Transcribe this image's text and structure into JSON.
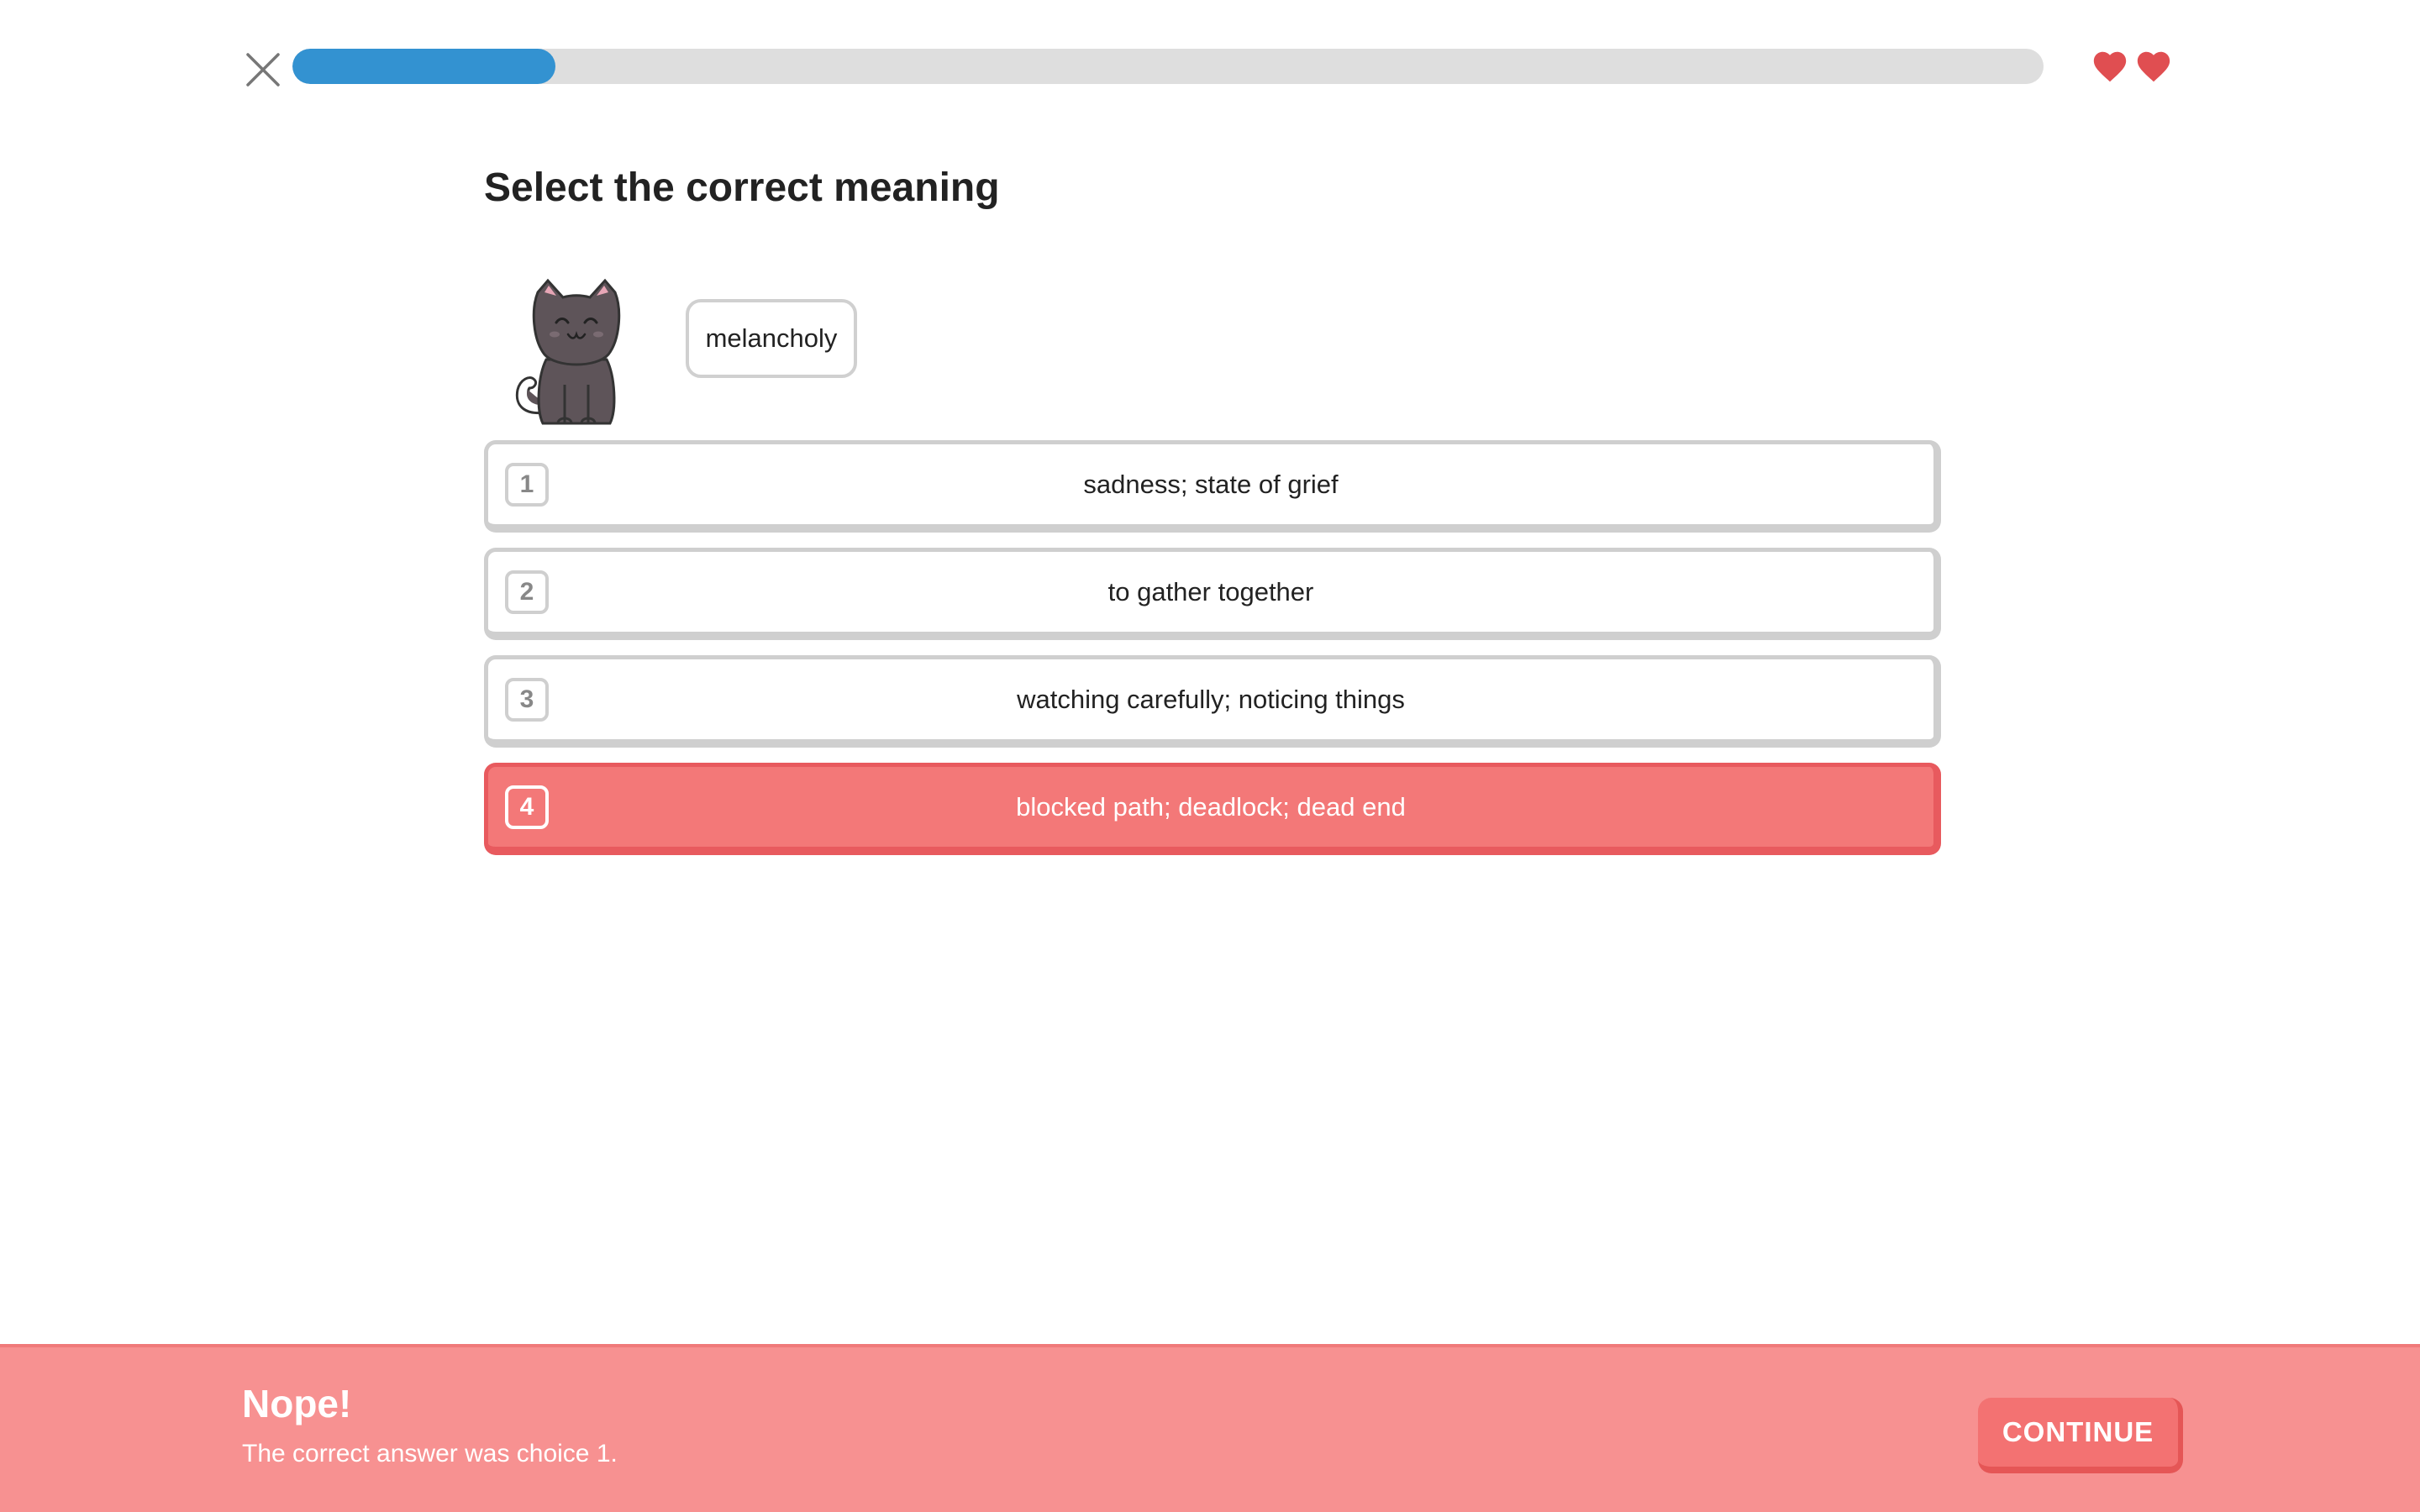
{
  "header": {
    "progress_percent": 15,
    "hearts_count": 2,
    "progress_color": "#3392d1",
    "heart_color": "#e04e51"
  },
  "prompt": {
    "title": "Select the correct meaning",
    "word": "melancholy",
    "mascot": "cat-icon"
  },
  "choices": [
    {
      "number": "1",
      "text": "sadness; state of grief",
      "state": "default"
    },
    {
      "number": "2",
      "text": "to gather together",
      "state": "default"
    },
    {
      "number": "3",
      "text": "watching carefully; noticing things",
      "state": "default"
    },
    {
      "number": "4",
      "text": "blocked path; deadlock; dead end",
      "state": "selected-wrong"
    }
  ],
  "feedback": {
    "title": "Nope!",
    "message": "The correct answer was choice 1.",
    "continue_label": "CONTINUE",
    "background_color": "#f79191"
  }
}
